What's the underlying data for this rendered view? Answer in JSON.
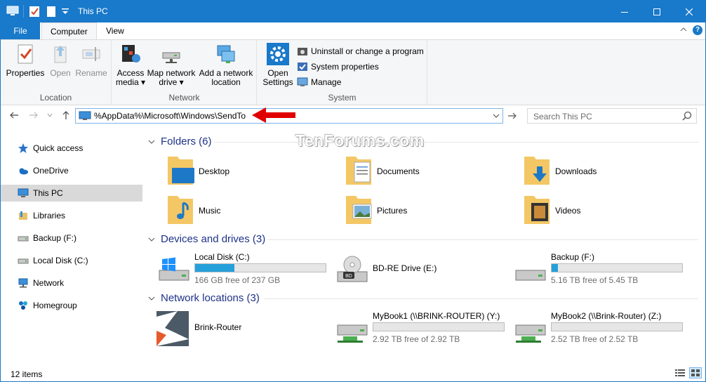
{
  "window": {
    "title": "This PC",
    "accent": "#1979ca"
  },
  "tabs": {
    "file": "File",
    "computer": "Computer",
    "view": "View",
    "help": "?"
  },
  "ribbon": {
    "location": {
      "label": "Location",
      "properties": "Properties",
      "open": "Open",
      "rename": "Rename"
    },
    "network": {
      "label": "Network",
      "access_media_1": "Access",
      "access_media_2": "media ▾",
      "map_drive_1": "Map network",
      "map_drive_2": "drive ▾",
      "add_location_1": "Add a network",
      "add_location_2": "location"
    },
    "system": {
      "label": "System",
      "open_settings_1": "Open",
      "open_settings_2": "Settings",
      "uninstall": "Uninstall or change a program",
      "system_properties": "System properties",
      "manage": "Manage"
    }
  },
  "address": {
    "path": "%AppData%\\Microsoft\\Windows\\SendTo",
    "search_placeholder": "Search This PC"
  },
  "watermark": "TenForums.com",
  "navpane": [
    {
      "label": "Quick access",
      "icon": "star-icon"
    },
    {
      "label": "OneDrive",
      "icon": "cloud-icon"
    },
    {
      "label": "This PC",
      "icon": "computer-icon",
      "selected": true
    },
    {
      "label": "Libraries",
      "icon": "library-icon"
    },
    {
      "label": "Backup (F:)",
      "icon": "drive-icon"
    },
    {
      "label": "Local Disk (C:)",
      "icon": "drive-icon"
    },
    {
      "label": "Network",
      "icon": "network-icon"
    },
    {
      "label": "Homegroup",
      "icon": "homegroup-icon"
    }
  ],
  "folders": {
    "header": "Folders (6)",
    "items": [
      {
        "name": "Desktop",
        "icon": "desktop-folder-icon"
      },
      {
        "name": "Documents",
        "icon": "documents-folder-icon"
      },
      {
        "name": "Downloads",
        "icon": "downloads-folder-icon"
      },
      {
        "name": "Music",
        "icon": "music-folder-icon"
      },
      {
        "name": "Pictures",
        "icon": "pictures-folder-icon"
      },
      {
        "name": "Videos",
        "icon": "videos-folder-icon"
      }
    ]
  },
  "devices": {
    "header": "Devices and drives (3)",
    "items": [
      {
        "name": "Local Disk (C:)",
        "free": "166 GB free of 237 GB",
        "used_fraction": 0.3
      },
      {
        "name": "BD-RE Drive (E:)",
        "free": "",
        "used_fraction": null
      },
      {
        "name": "Backup (F:)",
        "free": "5.16 TB free of 5.45 TB",
        "used_fraction": 0.05
      }
    ]
  },
  "network_locations": {
    "header": "Network locations (3)",
    "items": [
      {
        "name": "Brink-Router"
      },
      {
        "name": "MyBook1 (\\\\BRINK-ROUTER) (Y:)",
        "free": "2.92 TB free of 2.92 TB",
        "used_fraction": 0.0
      },
      {
        "name": "MyBook2 (\\\\Brink-Router) (Z:)",
        "free": "2.52 TB free of 2.52 TB",
        "used_fraction": 0.0
      }
    ]
  },
  "status": {
    "count": "12 items"
  }
}
